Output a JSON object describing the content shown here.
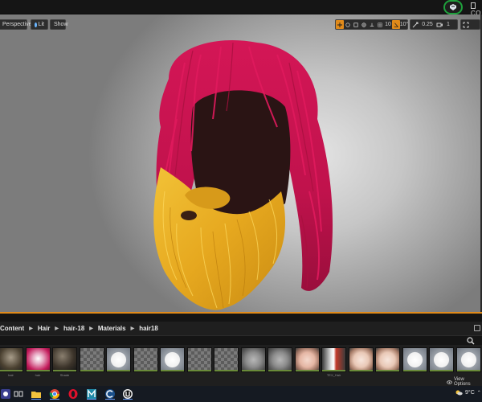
{
  "topbar": {
    "source_control_icon": "source-control-icon",
    "right_label": "CO"
  },
  "viewport": {
    "menu_icon": "chevron-down-icon",
    "perspective_label": "Perspective",
    "lit_label": "Lit",
    "show_label": "Show",
    "grid_snap_value": "10",
    "rotation_snap_value": "10°",
    "scale_snap_value": "0.25",
    "camera_speed_value": "1",
    "accent_color": "#e08a1a"
  },
  "content_browser": {
    "breadcrumb": [
      "Content",
      "Hair",
      "hair-18",
      "Materials",
      "hair18"
    ],
    "assets": [
      {
        "label": "hair",
        "thumb": "hair-mesh"
      },
      {
        "label": "hair",
        "thumb": "hair-pink"
      },
      {
        "label": "Shade",
        "thumb": "dark-sphere"
      },
      {
        "label": "",
        "thumb": "checker"
      },
      {
        "label": "",
        "thumb": "white-sphere"
      },
      {
        "label": "",
        "thumb": "checker"
      },
      {
        "label": "",
        "thumb": "white-sphere"
      },
      {
        "label": "",
        "thumb": "checker"
      },
      {
        "label": "",
        "thumb": "checker"
      },
      {
        "label": "",
        "thumb": "gray-head"
      },
      {
        "label": "",
        "thumb": "gray-head"
      },
      {
        "label": "",
        "thumb": "skin-sphere"
      },
      {
        "label": "TEX_Hair",
        "thumb": "hair-strip"
      },
      {
        "label": "",
        "thumb": "skin-head"
      },
      {
        "label": "",
        "thumb": "skin-head"
      },
      {
        "label": "",
        "thumb": "white-sphere"
      },
      {
        "label": "",
        "thumb": "white-sphere"
      },
      {
        "label": "",
        "thumb": "white-sphere"
      }
    ],
    "view_options_label": "View Options"
  },
  "taskbar": {
    "apps": [
      "start-icon",
      "task-view-icon",
      "file-explorer-icon",
      "chrome-icon",
      "opera-icon",
      "maya-icon",
      "cinema-icon",
      "unreal-engine-icon"
    ],
    "weather": "9°C"
  }
}
